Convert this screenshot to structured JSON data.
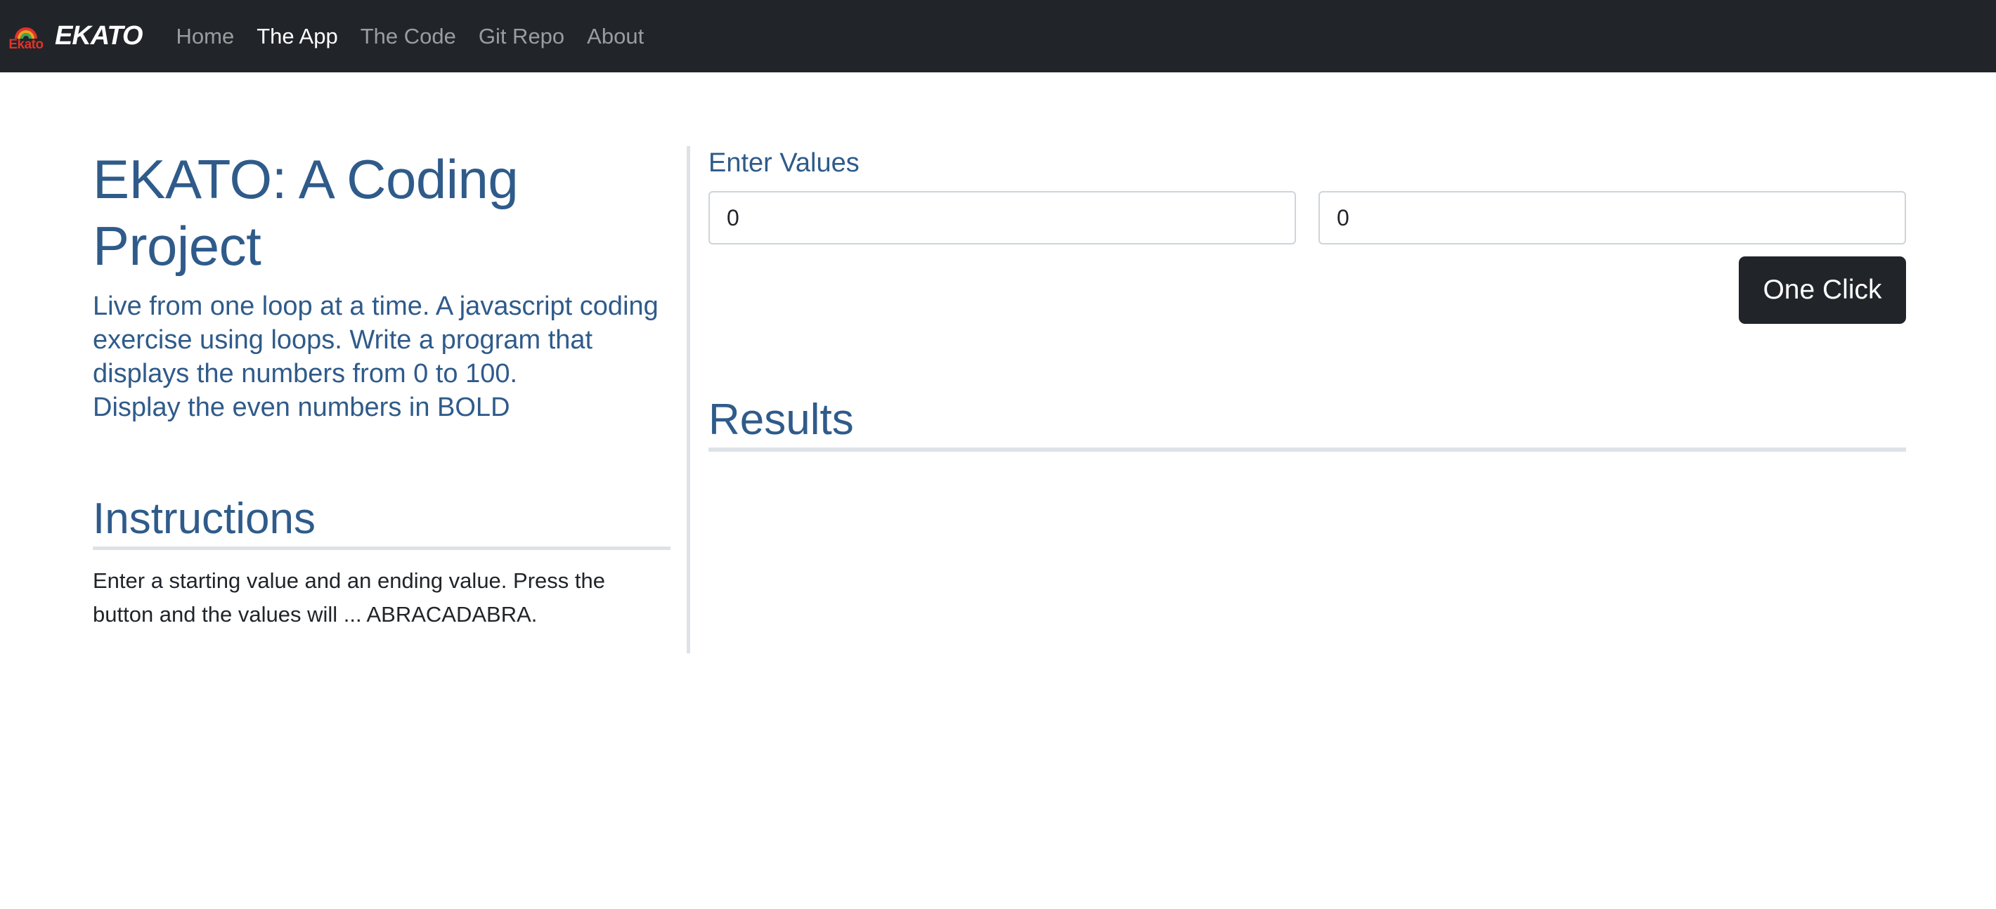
{
  "navbar": {
    "logo_text": "Ekato",
    "brand_name": "EKATO",
    "links": [
      {
        "label": "Home",
        "active": false
      },
      {
        "label": "The App",
        "active": true
      },
      {
        "label": "The Code",
        "active": false
      },
      {
        "label": "Git Repo",
        "active": false
      },
      {
        "label": "About",
        "active": false
      }
    ],
    "background": "#212529"
  },
  "intro": {
    "title": "EKATO: A Coding Project",
    "lead_line1": "Live from one loop at a time. A javascript coding exercise using loops. Write a program that displays the numbers from 0 to 100.",
    "lead_line2_prefix": "Display the even numbers in ",
    "lead_line2_bold": "BOLD"
  },
  "instructions": {
    "heading": "Instructions",
    "text": "Enter a starting value and an ending value. Press the button and the values will ... ABRACADABRA."
  },
  "form": {
    "label": "Enter Values",
    "start_value": "0",
    "end_value": "0",
    "button_label": "One Click"
  },
  "results": {
    "heading": "Results"
  },
  "colors": {
    "accent": "#2f5b8a",
    "navbar": "#212529",
    "button": "#212529",
    "logo_red": "#e0332b"
  }
}
